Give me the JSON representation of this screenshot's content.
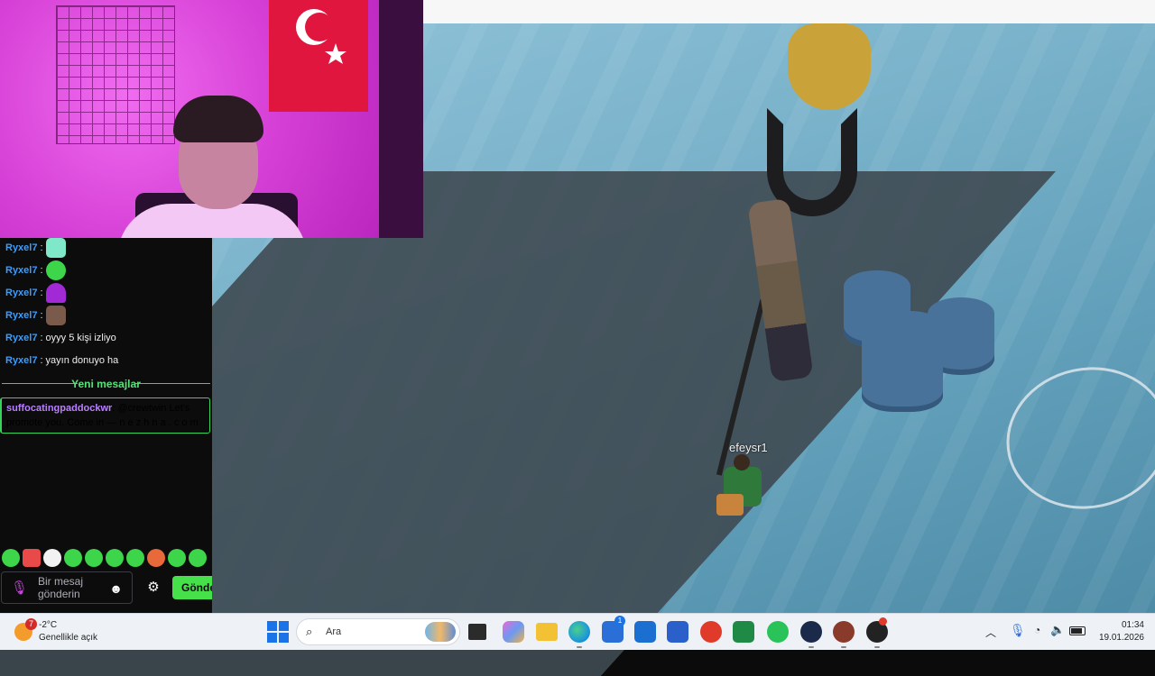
{
  "chat": {
    "messages": [
      {
        "user": "Ryxel7",
        "text": "",
        "emote": "ghost-emote",
        "emote_color": "#7ee8c8"
      },
      {
        "user": "Ryxel7",
        "text": "",
        "emote": "frog-emote",
        "emote_color": "#3dd64a"
      },
      {
        "user": "Ryxel7",
        "text": "",
        "emote": "wizard-hat-emote",
        "emote_color": "#a22ad6"
      },
      {
        "user": "Ryxel7",
        "text": "",
        "emote": "face-emote",
        "emote_color": "#7a5a4a"
      },
      {
        "user": "Ryxel7",
        "text": "oyyy 5 kişi izliyo",
        "emote": "",
        "emote_color": ""
      },
      {
        "user": "Ryxel7",
        "text": "yayın donuyo ha",
        "emote": "",
        "emote_color": ""
      }
    ],
    "separator": ":",
    "new_messages_label": "Yeni mesajlar",
    "highlight": {
      "user": "suffocatingpaddockwr",
      "text": "@crewtwin Let's promote  you. Come in — n e z h n a . c o m"
    },
    "emote_bar_colors": [
      "#3dd64a",
      "#e84a4a",
      "#f2f2f2",
      "#3dd64a",
      "#3dd64a",
      "#3dd64a",
      "#3dd64a",
      "#e86a3a",
      "#3dd64a",
      "#3dd64a"
    ],
    "input_placeholder": "Bir mesaj gönderin",
    "send_label": "Gönder"
  },
  "game": {
    "player_name": "efeysr1"
  },
  "taskbar": {
    "weather": {
      "temperature": "-2°C",
      "condition": "Genellikle açık",
      "badge": "7"
    },
    "search_placeholder": "Ara",
    "apps": [
      {
        "name": "task-view-icon",
        "color": "#2b2b2b",
        "running": false
      },
      {
        "name": "copilot-icon",
        "color": "#c76ad8",
        "running": false
      },
      {
        "name": "file-explorer-icon",
        "color": "#f2c234",
        "running": false
      },
      {
        "name": "edge-icon",
        "color": "#1f9ad6",
        "running": true
      },
      {
        "name": "store-icon",
        "color": "#2a6fd8",
        "running": false,
        "badge": "1"
      },
      {
        "name": "outlook-icon",
        "color": "#1b6fd0",
        "running": false
      },
      {
        "name": "word-icon",
        "color": "#2b5fc9",
        "running": false
      },
      {
        "name": "acrobat-icon",
        "color": "#e03a2a",
        "running": false
      },
      {
        "name": "excel-icon",
        "color": "#1f8a45",
        "running": false
      },
      {
        "name": "whatsapp-icon",
        "color": "#2ac35a",
        "running": false
      },
      {
        "name": "steam-icon",
        "color": "#1b2a4a",
        "running": true
      },
      {
        "name": "game-avatar-icon",
        "color": "#8a3a2a",
        "running": true
      },
      {
        "name": "obs-icon",
        "color": "#222222",
        "running": true
      }
    ],
    "clock": {
      "time": "01:34",
      "date": "19.01.2026"
    }
  }
}
